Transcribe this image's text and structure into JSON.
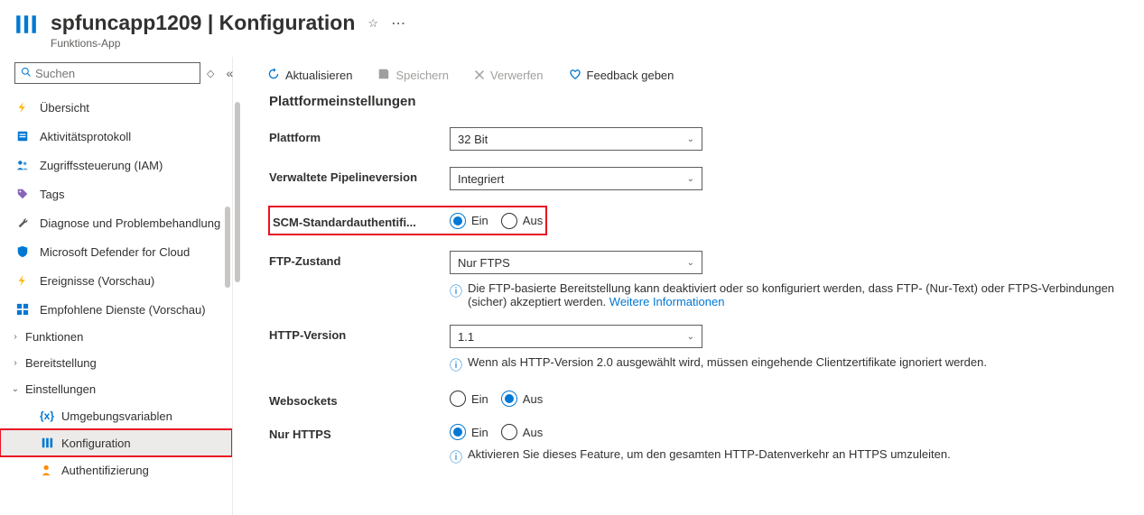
{
  "header": {
    "title": "spfuncapp1209 | Konfiguration",
    "subtitle": "Funktions-App"
  },
  "search": {
    "placeholder": "Suchen"
  },
  "nav": {
    "overview": "Übersicht",
    "activitylog": "Aktivitätsprotokoll",
    "iam": "Zugriffssteuerung (IAM)",
    "tags": "Tags",
    "diagnose": "Diagnose und Problembehandlung",
    "defender": "Microsoft Defender for Cloud",
    "events": "Ereignisse (Vorschau)",
    "recommended": "Empfohlene Dienste (Vorschau)",
    "functions": "Funktionen",
    "deployment": "Bereitstellung",
    "settings": "Einstellungen",
    "envvars": "Umgebungsvariablen",
    "config": "Konfiguration",
    "auth": "Authentifizierung"
  },
  "toolbar": {
    "refresh": "Aktualisieren",
    "save": "Speichern",
    "discard": "Verwerfen",
    "feedback": "Feedback geben"
  },
  "section": {
    "title": "Plattformeinstellungen"
  },
  "form": {
    "platform": {
      "label": "Plattform",
      "value": "32 Bit"
    },
    "pipeline": {
      "label": "Verwaltete Pipelineversion",
      "value": "Integriert"
    },
    "scm": {
      "label": "SCM-Standardauthentifi...",
      "on": "Ein",
      "off": "Aus"
    },
    "ftp": {
      "label": "FTP-Zustand",
      "value": "Nur FTPS",
      "info": "Die FTP-basierte Bereitstellung kann deaktiviert oder so konfiguriert werden, dass FTP- (Nur-Text) oder FTPS-Verbindungen (sicher) akzeptiert werden. ",
      "link": "Weitere Informationen"
    },
    "http": {
      "label": "HTTP-Version",
      "value": "1.1",
      "info": "Wenn als HTTP-Version 2.0 ausgewählt wird, müssen eingehende Clientzertifikate ignoriert werden."
    },
    "websockets": {
      "label": "Websockets",
      "on": "Ein",
      "off": "Aus"
    },
    "httpsonly": {
      "label": "Nur HTTPS",
      "on": "Ein",
      "off": "Aus",
      "info": "Aktivieren Sie dieses Feature, um den gesamten HTTP-Datenverkehr an HTTPS umzuleiten."
    }
  }
}
